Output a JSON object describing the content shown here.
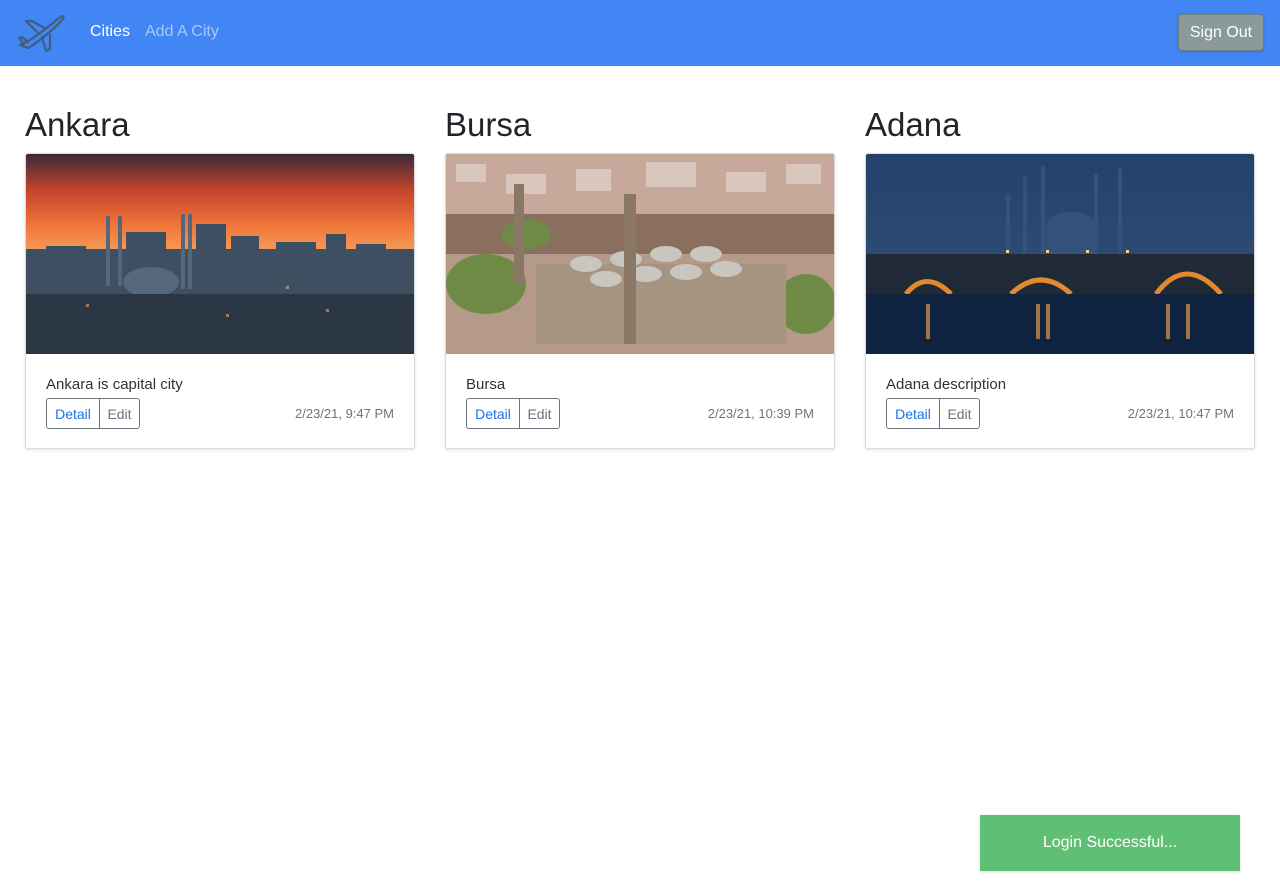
{
  "nav": {
    "brand_icon": "airplane-icon",
    "cities_label": "Cities",
    "add_city_label": "Add A City",
    "sign_out_label": "Sign Out"
  },
  "colors": {
    "navbar": "#4285f4",
    "sign_out_button": "#8a9a99",
    "toast": "#5fbf73",
    "detail_link": "#1a73e8"
  },
  "cities": [
    {
      "name": "Ankara",
      "description": "Ankara is capital city",
      "detail_label": "Detail",
      "edit_label": "Edit",
      "date": "2/23/21, 9:47 PM"
    },
    {
      "name": "Bursa",
      "description": "Bursa",
      "detail_label": "Detail",
      "edit_label": "Edit",
      "date": "2/23/21, 10:39 PM"
    },
    {
      "name": "Adana",
      "description": "Adana description",
      "detail_label": "Detail",
      "edit_label": "Edit",
      "date": "2/23/21, 10:47 PM"
    }
  ],
  "toast": {
    "message": "Login Successful..."
  }
}
